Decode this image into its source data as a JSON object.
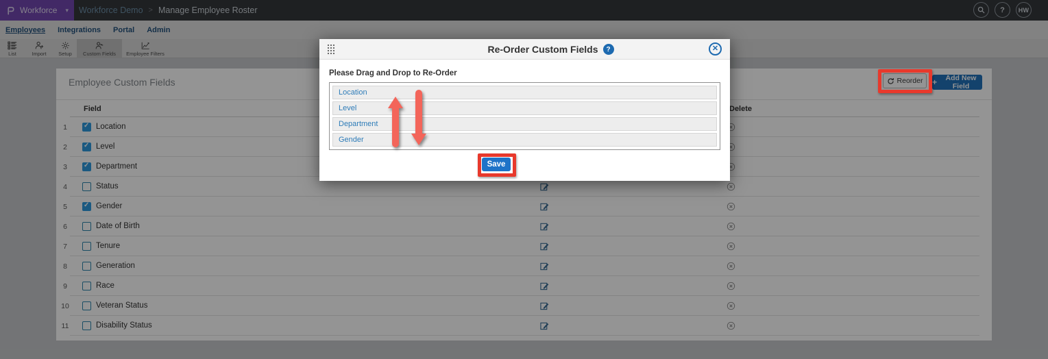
{
  "topbar": {
    "product": "Workforce",
    "caret": "▾",
    "breadcrumb": {
      "parent": "Workforce Demo",
      "separator": ">",
      "current": "Manage Employee Roster"
    },
    "help_glyph": "?",
    "avatar_initials": "HW"
  },
  "tabs": [
    {
      "label": "Employees",
      "active": true
    },
    {
      "label": "Integrations",
      "active": false
    },
    {
      "label": "Portal",
      "active": false
    },
    {
      "label": "Admin",
      "active": false
    }
  ],
  "toolbar": {
    "items": [
      {
        "label": "List"
      },
      {
        "label": "Import"
      },
      {
        "label": "Setup"
      },
      {
        "label": "Custom Fields",
        "active": true
      },
      {
        "label": "Employee Filters"
      }
    ]
  },
  "content": {
    "heading": "Employee Custom Fields",
    "reorder_button": "Reorder",
    "plus_glyph": "+",
    "add_button": "Add New Field",
    "table": {
      "field_header": "Field",
      "delete_header": "Delete",
      "rows": [
        {
          "num": "1",
          "label": "Location",
          "checked": true
        },
        {
          "num": "2",
          "label": "Level",
          "checked": true
        },
        {
          "num": "3",
          "label": "Department",
          "checked": true
        },
        {
          "num": "4",
          "label": "Status",
          "checked": false
        },
        {
          "num": "5",
          "label": "Gender",
          "checked": true
        },
        {
          "num": "6",
          "label": "Date of Birth",
          "checked": false
        },
        {
          "num": "7",
          "label": "Tenure",
          "checked": false
        },
        {
          "num": "8",
          "label": "Generation",
          "checked": false
        },
        {
          "num": "9",
          "label": "Race",
          "checked": false
        },
        {
          "num": "10",
          "label": "Veteran Status",
          "checked": false
        },
        {
          "num": "11",
          "label": "Disability Status",
          "checked": false
        }
      ]
    }
  },
  "modal": {
    "title": "Re-Order Custom Fields",
    "help_glyph": "?",
    "close_glyph": "✕",
    "instruction": "Please Drag and Drop to Re-Order",
    "items": [
      "Location",
      "Level",
      "Department",
      "Gender"
    ],
    "save_button": "Save"
  },
  "colors": {
    "accent_purple": "#7347b0",
    "brand_blue": "#1e73c8",
    "annotation_red": "#e8392c",
    "arrow_red": "#f3655a",
    "checkbox_blue": "#2d9ade"
  }
}
